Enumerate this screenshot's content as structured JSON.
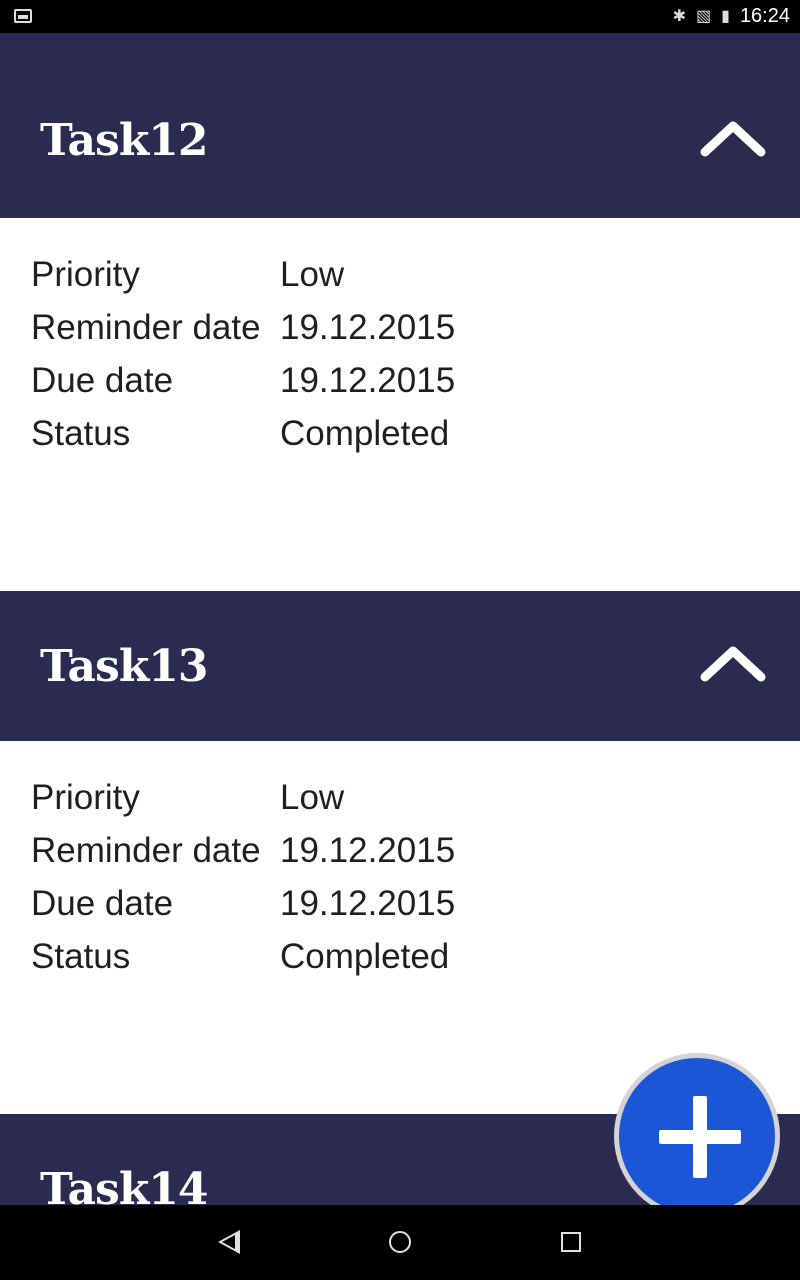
{
  "status_bar": {
    "time": "16:24",
    "icons": [
      "image-icon",
      "bluetooth-icon",
      "no-sim-icon",
      "battery-icon"
    ]
  },
  "tasks": [
    {
      "title": "Task12",
      "expanded": true,
      "fields": [
        {
          "label": "Priority",
          "value": "Low"
        },
        {
          "label": "Reminder date",
          "value": "19.12.2015"
        },
        {
          "label": "Due date",
          "value": "19.12.2015"
        },
        {
          "label": "Status",
          "value": "Completed"
        }
      ]
    },
    {
      "title": "Task13",
      "expanded": true,
      "fields": [
        {
          "label": "Priority",
          "value": "Low"
        },
        {
          "label": "Reminder date",
          "value": "19.12.2015"
        },
        {
          "label": "Due date",
          "value": "19.12.2015"
        },
        {
          "label": "Status",
          "value": "Completed"
        }
      ]
    },
    {
      "title": "Task14"
    }
  ],
  "fab": {
    "icon": "plus-icon"
  },
  "navigation_bar": {
    "icons": [
      "back-icon",
      "home-icon",
      "recents-icon"
    ]
  },
  "colors": {
    "header": "#2b2b52",
    "fab": "#1a56d6",
    "text": "#1f1f1f"
  }
}
